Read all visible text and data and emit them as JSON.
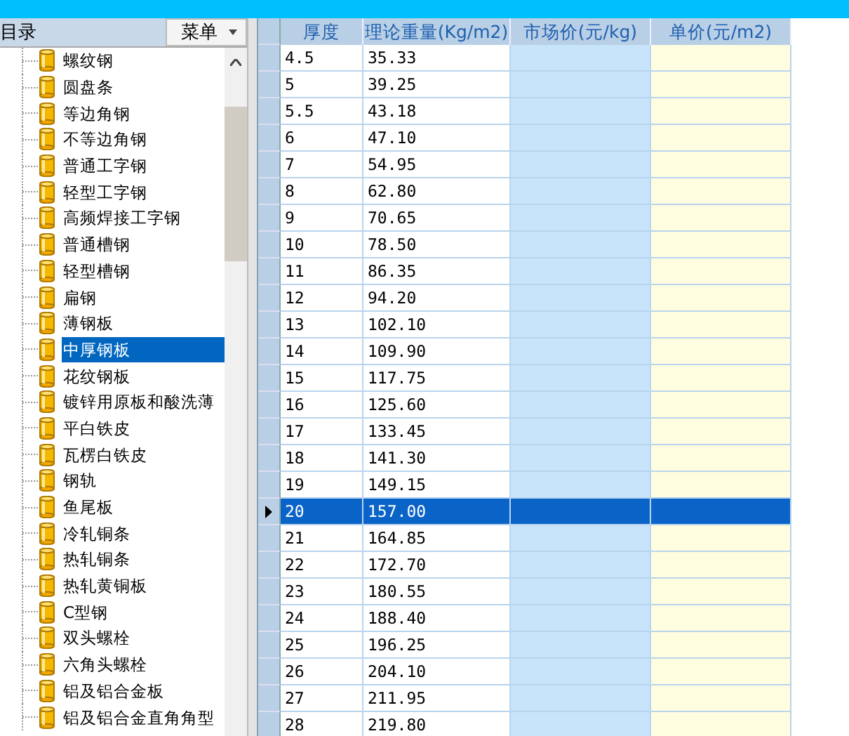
{
  "sidebar": {
    "title": "目录",
    "menu_button": "菜单",
    "items": [
      {
        "label": "螺纹钢",
        "selected": false
      },
      {
        "label": "圆盘条",
        "selected": false
      },
      {
        "label": "等边角钢",
        "selected": false
      },
      {
        "label": "不等边角钢",
        "selected": false
      },
      {
        "label": "普通工字钢",
        "selected": false
      },
      {
        "label": "轻型工字钢",
        "selected": false
      },
      {
        "label": "高频焊接工字钢",
        "selected": false
      },
      {
        "label": "普通槽钢",
        "selected": false
      },
      {
        "label": "轻型槽钢",
        "selected": false
      },
      {
        "label": "扁钢",
        "selected": false
      },
      {
        "label": "薄钢板",
        "selected": false
      },
      {
        "label": "中厚钢板",
        "selected": true
      },
      {
        "label": "花纹钢板",
        "selected": false
      },
      {
        "label": "镀锌用原板和酸洗薄",
        "selected": false
      },
      {
        "label": "平白铁皮",
        "selected": false
      },
      {
        "label": "瓦楞白铁皮",
        "selected": false
      },
      {
        "label": "钢轨",
        "selected": false
      },
      {
        "label": "鱼尾板",
        "selected": false
      },
      {
        "label": "冷轧铜条",
        "selected": false
      },
      {
        "label": "热轧铜条",
        "selected": false
      },
      {
        "label": "热轧黄铜板",
        "selected": false
      },
      {
        "label": "C型钢",
        "selected": false
      },
      {
        "label": "双头螺栓",
        "selected": false
      },
      {
        "label": "六角头螺栓",
        "selected": false
      },
      {
        "label": "铝及铝合金板",
        "selected": false
      },
      {
        "label": "铝及铝合金直角角型",
        "selected": false
      }
    ]
  },
  "table": {
    "columns": [
      "厚度",
      "理论重量(Kg/m2)",
      "市场价(元/kg)",
      "单价(元/m2)"
    ],
    "rows": [
      {
        "cells": [
          "4.5",
          "35.33"
        ],
        "selected": false
      },
      {
        "cells": [
          "5",
          "39.25"
        ],
        "selected": false
      },
      {
        "cells": [
          "5.5",
          "43.18"
        ],
        "selected": false
      },
      {
        "cells": [
          "6",
          "47.10"
        ],
        "selected": false
      },
      {
        "cells": [
          "7",
          "54.95"
        ],
        "selected": false
      },
      {
        "cells": [
          "8",
          "62.80"
        ],
        "selected": false
      },
      {
        "cells": [
          "9",
          "70.65"
        ],
        "selected": false
      },
      {
        "cells": [
          "10",
          "78.50"
        ],
        "selected": false
      },
      {
        "cells": [
          "11",
          "86.35"
        ],
        "selected": false
      },
      {
        "cells": [
          "12",
          "94.20"
        ],
        "selected": false
      },
      {
        "cells": [
          "13",
          "102.10"
        ],
        "selected": false
      },
      {
        "cells": [
          "14",
          "109.90"
        ],
        "selected": false
      },
      {
        "cells": [
          "15",
          "117.75"
        ],
        "selected": false
      },
      {
        "cells": [
          "16",
          "125.60"
        ],
        "selected": false
      },
      {
        "cells": [
          "17",
          "133.45"
        ],
        "selected": false
      },
      {
        "cells": [
          "18",
          "141.30"
        ],
        "selected": false
      },
      {
        "cells": [
          "19",
          "149.15"
        ],
        "selected": false
      },
      {
        "cells": [
          "20",
          "157.00"
        ],
        "selected": true
      },
      {
        "cells": [
          "21",
          "164.85"
        ],
        "selected": false
      },
      {
        "cells": [
          "22",
          "172.70"
        ],
        "selected": false
      },
      {
        "cells": [
          "23",
          "180.55"
        ],
        "selected": false
      },
      {
        "cells": [
          "24",
          "188.40"
        ],
        "selected": false
      },
      {
        "cells": [
          "25",
          "196.25"
        ],
        "selected": false
      },
      {
        "cells": [
          "26",
          "204.10"
        ],
        "selected": false
      },
      {
        "cells": [
          "27",
          "211.95"
        ],
        "selected": false
      },
      {
        "cells": [
          "28",
          "219.80"
        ],
        "selected": false
      }
    ]
  }
}
